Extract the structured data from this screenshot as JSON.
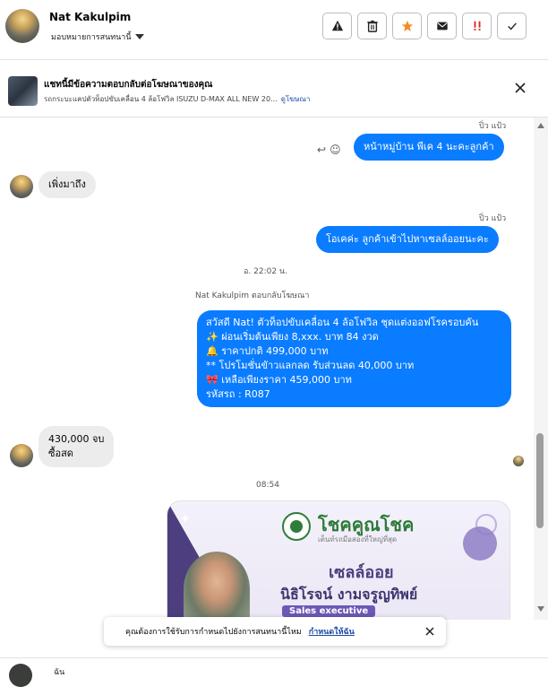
{
  "header": {
    "name": "Nat Kakulpim",
    "assign_label": "มอบหมายการสนทนานี้",
    "actions": [
      {
        "icon": "warning-icon",
        "glyph": "⚠"
      },
      {
        "icon": "trash-icon",
        "glyph": "🗑"
      },
      {
        "icon": "star-icon",
        "glyph": "★"
      },
      {
        "icon": "mail-icon",
        "glyph": "✉"
      },
      {
        "icon": "important-icon",
        "glyph": "!!"
      },
      {
        "icon": "check-icon",
        "glyph": "✓"
      }
    ]
  },
  "ad": {
    "title": "แชทนี้มีข้อความตอบกลับต่อโฆษณาของคุณ",
    "subtitle": "รถกระบะแคปตัวท็อปขับเคลื่อน 4 ล้อโฟวิล ISUZU D-MAX ALL NEW 20...",
    "link": "ดูโฆษณา"
  },
  "messages": {
    "sender1": "ปิ่ว แป้ว",
    "m1": "หน้าหมู่บ้าน พีเค 4 นะคะลูกค้า",
    "m2": "เพิ่งมาถึง",
    "sender2": "ปิ่ว แป้ว",
    "m3": "โอเคค่ะ ลูกค้าเข้าไปหาเซลล์ออยนะคะ",
    "time1": "อ. 22:02 น.",
    "reply_note": "Nat Kakulpim ตอบกลับโฆษณา",
    "m4_lines": [
      "สวัสดี Nat! ตัวท็อปขับเคลื่อน 4 ล้อโฟวิล ชุดแต่งออฟโรครอบคัน",
      "✨  ผ่อนเริ่มต้นเพียง 8,xxx. บาท 84 งวด",
      "🔔 ราคาปกติ 499,000 บาท",
      "** โปรโมชั่นขัาวแลกลด รับส่วนลด 40,000 บาท",
      "🎀  เหลือเพียงราคา 459,000 บาท",
      " รหัสรถ : R087"
    ],
    "m5_lines": [
      "430,000 จบ",
      "ซื้อสด"
    ],
    "time2": "08:54"
  },
  "card": {
    "brand": "โชคคูณโชค",
    "tagline": "เต็นท์รถมือสองที่ใหญ่ที่สุด",
    "role": "เซลล์ออย",
    "name": "นิธิโรจน์  งามจรูญทิพย์",
    "badge": "Sales executive"
  },
  "toast": {
    "text": "คุณต้องการใช้รับการกำหนดไปยังการสนทนานี้ไหม",
    "link": "กำหนดให้ฉัน"
  },
  "composer": {
    "text": "ฉัน"
  }
}
